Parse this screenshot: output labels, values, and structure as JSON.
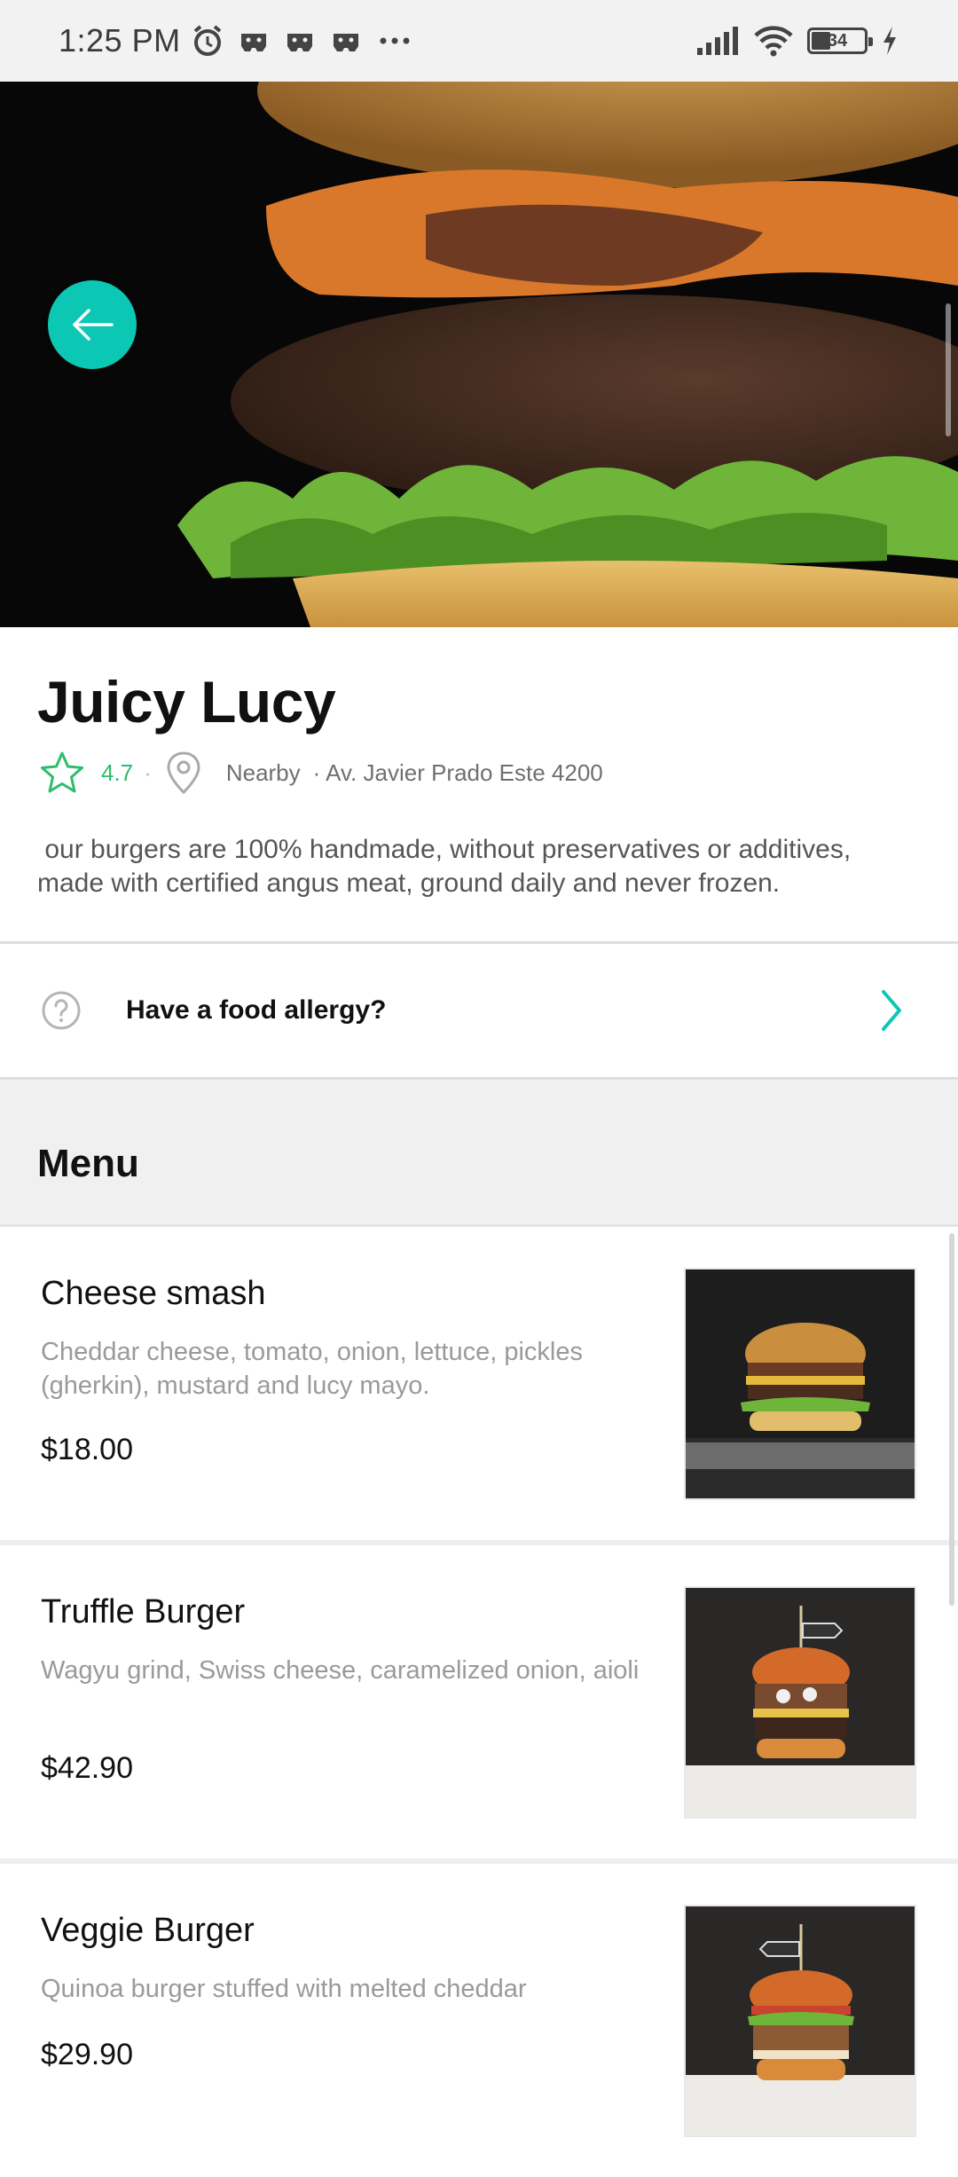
{
  "status_bar": {
    "time": "1:25 PM",
    "battery": "34",
    "icons": [
      "alarm-icon",
      "game-controller-icon",
      "game-controller-icon",
      "game-controller-icon",
      "more-icon",
      "signal-icon",
      "wifi-icon",
      "battery-icon",
      "charging-icon"
    ]
  },
  "restaurant": {
    "name": "Juicy Lucy",
    "rating": "4.7",
    "rating_dot": "·",
    "distance": "Nearby",
    "address": "· Av. Javier Prado Este 4200",
    "description": " our burgers are 100% handmade, without preservatives or additives,\nmade with certified angus meat, ground daily and never frozen."
  },
  "allergy": {
    "label": "Have a food allergy?"
  },
  "menu": {
    "title": "Menu",
    "items": [
      {
        "name": "Cheese smash",
        "description": "Cheddar cheese, tomato, onion, lettuce, pickles (gherkin), mustard and lucy mayo.",
        "price": "$18.00"
      },
      {
        "name": "Truffle Burger",
        "description": "Wagyu grind, Swiss cheese, caramelized onion, aioli",
        "price": "$42.90"
      },
      {
        "name": " Veggie Burger",
        "description": "Quinoa burger stuffed with melted cheddar",
        "price": "$29.90"
      }
    ]
  },
  "colors": {
    "accent": "#0cc7b4",
    "rating": "#2ebd6b"
  }
}
